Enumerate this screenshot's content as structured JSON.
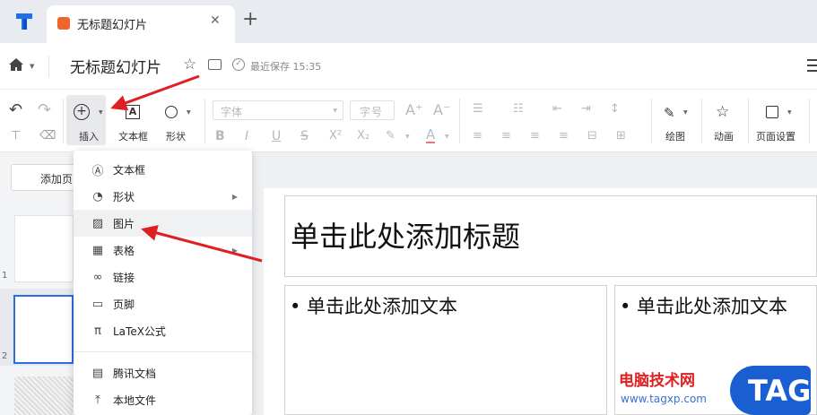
{
  "tab": {
    "title": "无标题幻灯片",
    "new_tab": "+"
  },
  "titlebar": {
    "doc_title": "无标题幻灯片",
    "save_status": "最近保存 15:35"
  },
  "toolbar": {
    "undo": "↶",
    "redo": "↷",
    "insert_label": "插入",
    "textbox_label": "文本框",
    "shape_label": "形状",
    "font_placeholder": "字体",
    "size_placeholder": "号",
    "size_prefix": "字",
    "draw_label": "绘图",
    "animation_label": "动画",
    "page_setup_label": "页面设置"
  },
  "leftpanel": {
    "add_page": "添加页",
    "slide_numbers": [
      "1",
      "2"
    ]
  },
  "slide": {
    "title_placeholder": "单击此处添加标题",
    "text_placeholder_left": "• 单击此处添加文本",
    "text_placeholder_right": "• 单击此处添加文本"
  },
  "menu": {
    "items": [
      {
        "label": "文本框",
        "icon": "textbox-icon",
        "submenu": false
      },
      {
        "label": "形状",
        "icon": "shape-icon",
        "submenu": true
      },
      {
        "label": "图片",
        "icon": "image-icon",
        "submenu": false
      },
      {
        "label": "表格",
        "icon": "table-icon",
        "submenu": true
      },
      {
        "label": "链接",
        "icon": "link-icon",
        "submenu": false
      },
      {
        "label": "页脚",
        "icon": "footer-icon",
        "submenu": false
      },
      {
        "label": "LaTeX公式",
        "icon": "pi-icon",
        "submenu": false
      },
      {
        "label": "腾讯文档",
        "icon": "tencent-docs-icon",
        "submenu": false
      },
      {
        "label": "本地文件",
        "icon": "upload-icon",
        "submenu": false
      }
    ]
  },
  "watermark": {
    "site": "电脑技术网",
    "url": "www.tagxp.com",
    "badge": "TAG"
  },
  "colors": {
    "accent": "#2b6de5",
    "arrow": "#e02020",
    "brand": "#1a73e8",
    "tag_bg": "#1a5fd1"
  }
}
